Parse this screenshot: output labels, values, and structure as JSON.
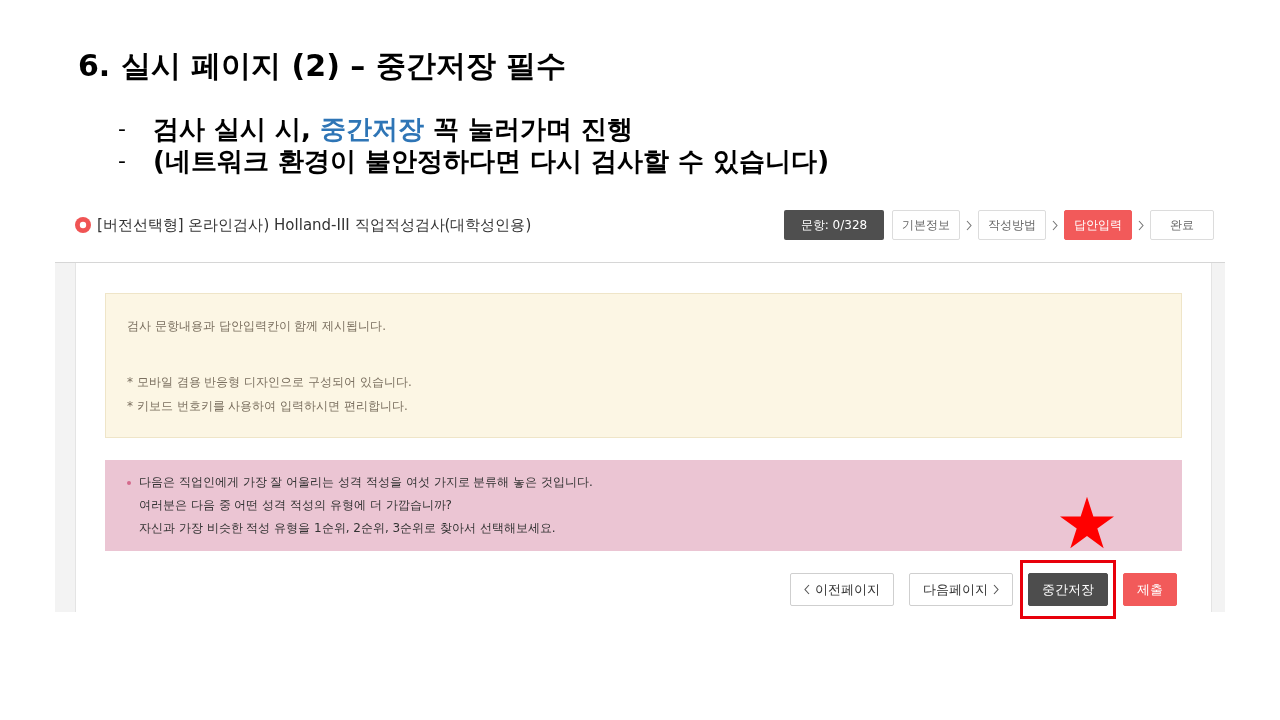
{
  "slide": {
    "title": "6. 실시 페이지 (2) – 중간저장 필수",
    "bullets": [
      {
        "marker": "-",
        "segments": [
          {
            "text": "검사 실시 시, ",
            "highlight": false
          },
          {
            "text": "중간저장",
            "highlight": true
          },
          {
            "text": " 꼭 눌러가며 진행",
            "highlight": false
          }
        ]
      },
      {
        "marker": "-",
        "segments": [
          {
            "text": "(네트워크 환경이 불안정하다면 다시 검사할 수 있습니다)",
            "highlight": false
          }
        ]
      }
    ]
  },
  "exam": {
    "title": "[버전선택형] 온라인검사) Holland-III 직업적성검사(대학성인용)",
    "counter": "문항: 0/328",
    "steps": [
      {
        "label": "기본정보",
        "selected": false
      },
      {
        "label": "작성방법",
        "selected": false
      },
      {
        "label": "답안입력",
        "selected": true
      },
      {
        "label": "완료",
        "selected": false
      }
    ]
  },
  "notice": {
    "paragraphs": [
      [
        "검사 문항내용과 답안입력칸이 함께 제시됩니다."
      ],
      [
        "* 모바일 겸용 반응형 디자인으로 구성되어 있습니다.",
        "* 키보드 번호키를 사용하여 입력하시면 편리합니다."
      ]
    ]
  },
  "question": {
    "lines": [
      "다음은 직업인에게 가장 잘 어울리는 성격 적성을 여섯 가지로 분류해 놓은 것입니다.",
      "여러분은 다음 중 어떤 성격 적성의 유형에 더 가깝습니까?",
      "자신과 가장 비슷한 적성 유형을 1순위, 2순위, 3순위로 찾아서 선택해보세요."
    ]
  },
  "actions": {
    "buttons": [
      {
        "label": "이전페이지",
        "kind": "prev",
        "highlighted": false
      },
      {
        "label": "다음페이지",
        "kind": "next",
        "highlighted": false
      },
      {
        "label": "중간저장",
        "kind": "save",
        "highlighted": true
      },
      {
        "label": "제출",
        "kind": "submit",
        "highlighted": false
      }
    ]
  }
}
